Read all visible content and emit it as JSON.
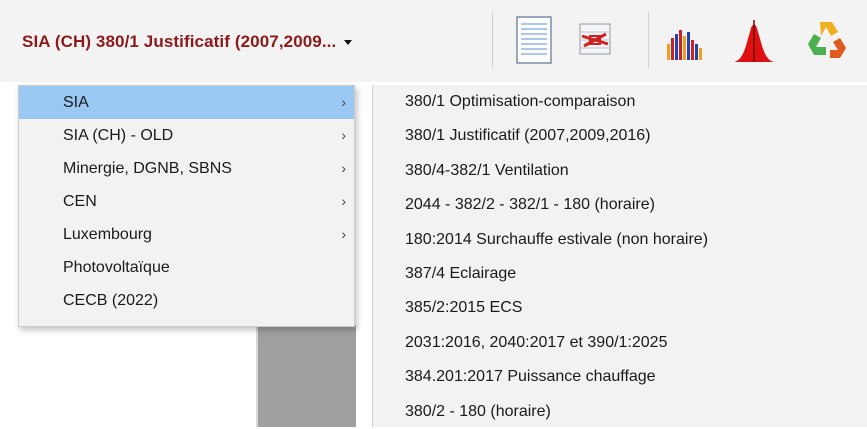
{
  "toolbar": {
    "combo_value": "SIA (CH) 380/1 Justificatif (2007,2009...",
    "icons": [
      "notepad-icon",
      "floorplan-icon",
      "bar-chart-icon",
      "distribution-peak-icon",
      "recycle-icon"
    ]
  },
  "menu": {
    "items": [
      {
        "label": "SIA",
        "has_submenu": true,
        "active": true
      },
      {
        "label": "SIA (CH) - OLD",
        "has_submenu": true
      },
      {
        "label": "Minergie, DGNB, SBNS",
        "has_submenu": true
      },
      {
        "label": "CEN",
        "has_submenu": true
      },
      {
        "label": "Luxembourg",
        "has_submenu": true
      },
      {
        "label": "Photovoltaïque",
        "has_submenu": false
      },
      {
        "label": "CECB (2022)",
        "has_submenu": false
      }
    ],
    "chevron": "›"
  },
  "submenu": {
    "items": [
      "380/1 Optimisation-comparaison",
      "380/1 Justificatif (2007,2009,2016)",
      "380/4-382/1 Ventilation",
      "2044 - 382/2 - 382/1 - 180 (horaire)",
      "180:2014 Surchauffe estivale (non horaire)",
      "387/4 Eclairage",
      "385/2:2015 ECS",
      "2031:2016, 2040:2017 et 390/1:2025",
      "384.201:2017 Puissance chauffage",
      "380/2 - 180 (horaire)"
    ]
  },
  "colors": {
    "accent_text": "#8b1a1a",
    "highlight": "#99c9f2",
    "menu_bg": "#f2f2f2"
  }
}
